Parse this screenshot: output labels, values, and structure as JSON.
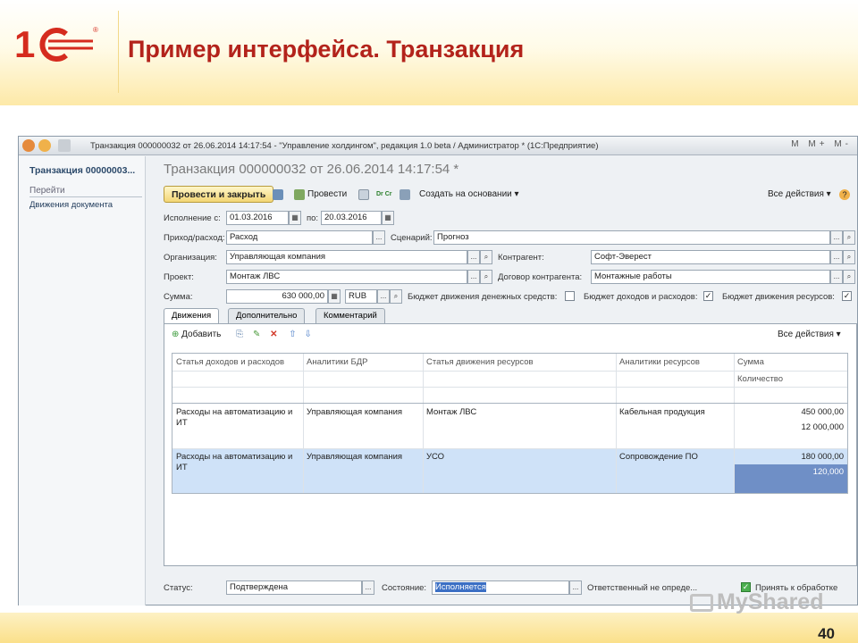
{
  "slide": {
    "title": "Пример интерфейса. Транзакция",
    "page_number": "40",
    "watermark": "MyShared",
    "logo_text": "1С"
  },
  "window": {
    "title": "Транзакция 000000032 от 26.06.2014 14:17:54 - \"Управление холдингом\", редакция 1.0 beta / Администратор * (1С:Предприятие)",
    "title_right": "M M+ M-"
  },
  "sidebar": {
    "title": "Транзакция 00000003...",
    "section": "Перейти",
    "link": "Движения документа"
  },
  "doc": {
    "title": "Транзакция 000000032 от 26.06.2014 14:17:54 *"
  },
  "toolbar": {
    "post_close": "Провести и закрыть",
    "post": "Провести",
    "create_based": "Создать на основании ▾",
    "all_actions": "Все действия ▾",
    "dr_cr": "Dr Cr"
  },
  "form": {
    "exec_from_label": "Исполнение с:",
    "exec_from": "01.03.2016",
    "to_label": "по:",
    "to": "20.03.2016",
    "inout_label": "Приход/расход:",
    "inout": "Расход",
    "scenario_label": "Сценарий:",
    "scenario": "Прогноз",
    "org_label": "Организация:",
    "org": "Управляющая компания",
    "contractor_label": "Контрагент:",
    "contractor": "Софт-Эверест",
    "project_label": "Проект:",
    "project": "Монтаж ЛВС",
    "contract_label": "Договор контрагента:",
    "contract": "Монтажные работы",
    "sum_label": "Сумма:",
    "sum": "630 000,00",
    "currency": "RUB",
    "cb_cash_label": "Бюджет движения денежных средств:",
    "cb_cash": false,
    "cb_income_label": "Бюджет доходов и расходов:",
    "cb_income": true,
    "cb_resources_label": "Бюджет движения ресурсов:",
    "cb_resources": true
  },
  "tabs": [
    "Движения",
    "Дополнительно",
    "Комментарий"
  ],
  "table": {
    "add": "Добавить",
    "all_actions": "Все действия ▾",
    "headers": [
      "Статья доходов и расходов",
      "Аналитики БДР",
      "Статья движения ресурсов",
      "Аналитики ресурсов",
      "Сумма"
    ],
    "sub_header": "Количество",
    "rows": [
      {
        "article": "Расходы на автоматизацию и",
        "article2": "ИТ",
        "bdr": "Управляющая компания",
        "resource": "Монтаж ЛВС",
        "res_analytics": "Кабельная продукция",
        "sum": "450 000,00",
        "qty": "12 000,000"
      },
      {
        "article": "Расходы на автоматизацию и",
        "article2": "ИТ",
        "bdr": "Управляющая компания",
        "resource": "УСО",
        "res_analytics": "Сопровождение ПО",
        "sum": "180 000,00",
        "qty": "120,000"
      }
    ]
  },
  "footer": {
    "status_label": "Статус:",
    "status": "Подтверждена",
    "state_label": "Состояние:",
    "state": "Исполняется",
    "responsible": "Ответственный не опреде...",
    "accept_label": "Принять к обработке",
    "accept": true
  },
  "colors": {
    "title_red": "#b3231b",
    "selection": "#cfe2f8",
    "selected_cell": "#6f8fc6"
  }
}
